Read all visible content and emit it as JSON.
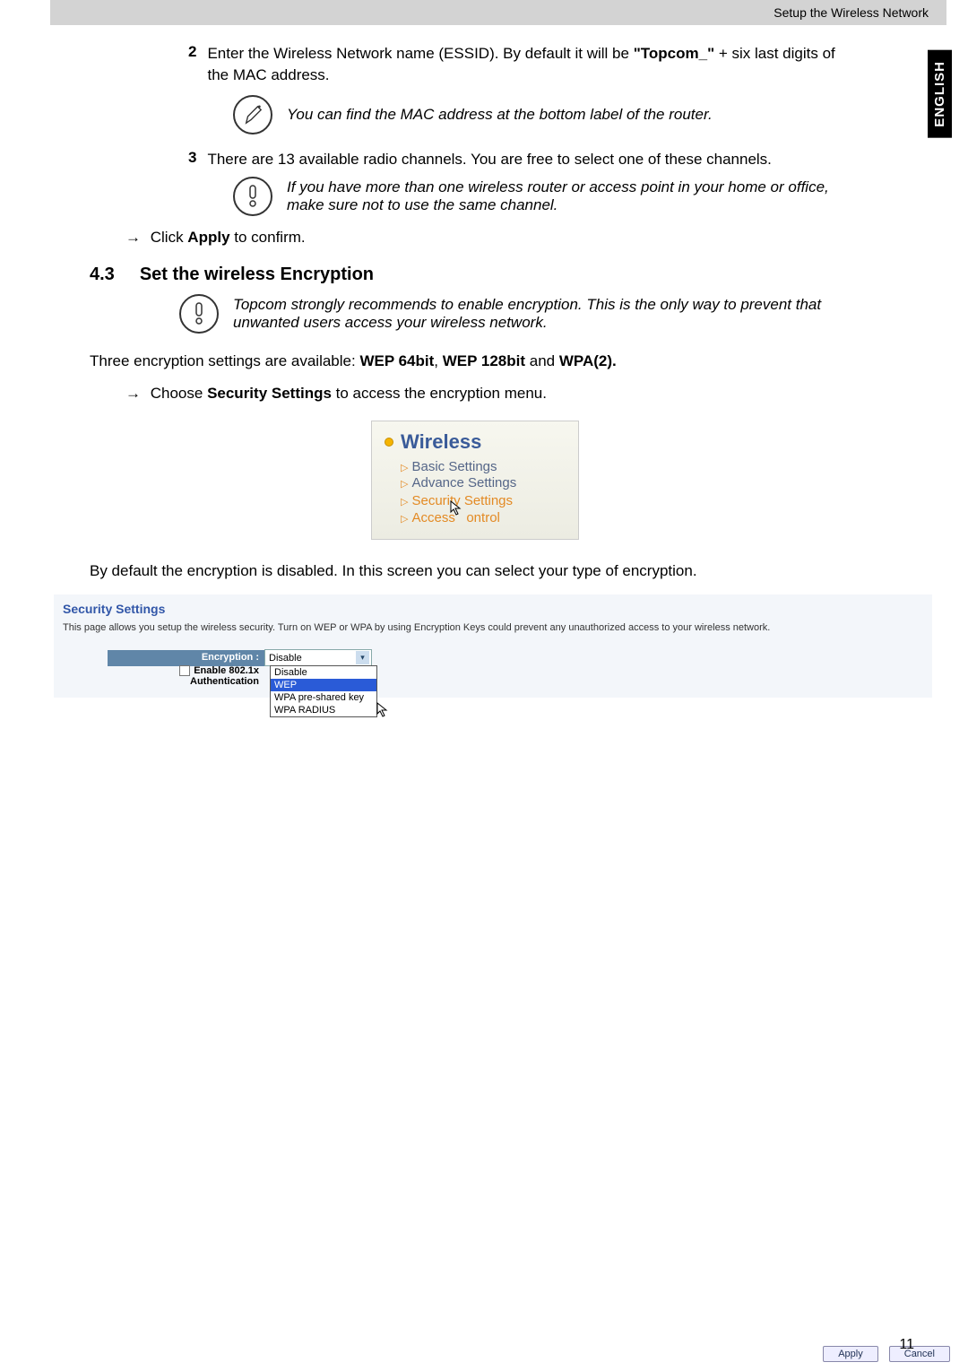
{
  "header": {
    "breadcrumb": "Setup the Wireless Network"
  },
  "lang_tab": "ENGLISH",
  "step2": {
    "num": "2",
    "text_a": "Enter the Wireless Network name (ESSID). By default it will be ",
    "text_b": "\"Topcom_\"",
    "text_c": " + six last digits of the MAC address."
  },
  "note_pencil": "You can find the MAC address at the bottom label of the router.",
  "step3": {
    "num": "3",
    "text": "There are 13 available radio channels. You are free to select one of these channels."
  },
  "warn1": "If you have more than one wireless router or access point in your home or office, make sure not to use the same channel.",
  "click_apply": {
    "prefix": "Click ",
    "bold": "Apply",
    "suffix": " to confirm."
  },
  "section": {
    "num": "4.3",
    "title": "Set the wireless Encryption"
  },
  "warn2": "Topcom strongly recommends to enable encryption. This is the only way to prevent that unwanted users access your wireless network.",
  "three_enc": {
    "a": "Three encryption settings are available: ",
    "b1": "WEP 64bit",
    "c1": ", ",
    "b2": "WEP 128bit",
    "c2": " and ",
    "b3": "WPA(2)."
  },
  "choose_sec": {
    "prefix": "Choose ",
    "bold": "Security Settings",
    "suffix": " to access the encryption menu."
  },
  "menu": {
    "title": "Wireless",
    "items": [
      "Basic Settings",
      "Advance Settings",
      "Security Settings",
      "Access Control"
    ],
    "item3_part1": "Security",
    "item3_part2": "Settings",
    "item4_part1": "Access",
    "item4_part2": "ontrol"
  },
  "by_default": "By default the encryption is disabled. In this screen you can select your type of encryption.",
  "panel": {
    "title": "Security Settings",
    "desc": "This page allows you setup the wireless security. Turn on WEP or WPA by using Encryption Keys could prevent any unauthorized access to your wireless network.",
    "enc_label": "Encryption :",
    "enc_value": "Disable",
    "auth_label": "Enable 802.1x Authentication",
    "options": [
      "Disable",
      "WEP",
      "WPA pre-shared key",
      "WPA RADIUS"
    ],
    "apply": "Apply",
    "cancel": "Cancel"
  },
  "page_num": "11"
}
